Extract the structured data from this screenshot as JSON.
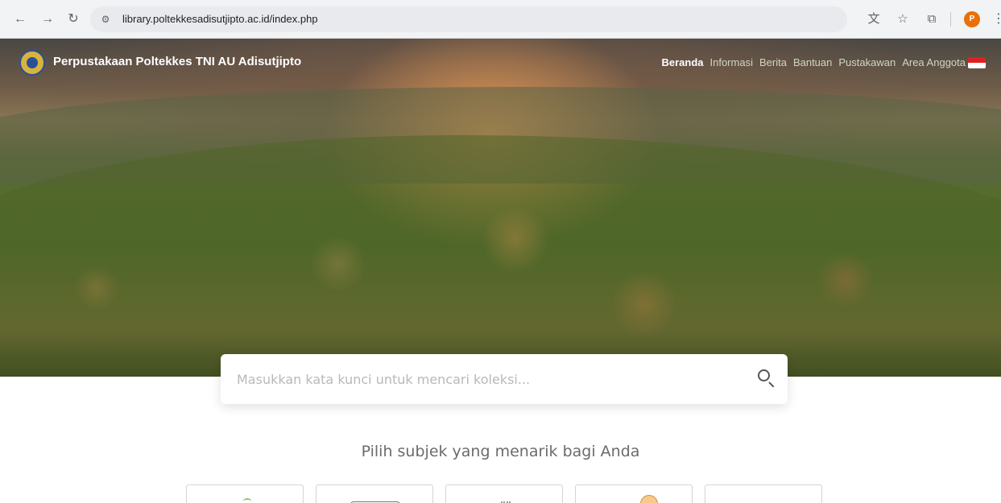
{
  "browser": {
    "url": "library.poltekkesadisutjipto.ac.id/index.php",
    "back_icon": "arrow-left",
    "forward_icon": "arrow-right",
    "reload_icon": "reload",
    "site_info_icon": "tune",
    "translate_icon": "translate",
    "bookmark_icon": "star",
    "extensions_icon": "puzzle",
    "profile_initial": "P",
    "menu_icon": "more-vertical"
  },
  "site": {
    "title": "Perpustakaan Poltekkes TNI AU Adisutjipto",
    "nav": [
      {
        "label": "Beranda",
        "active": true
      },
      {
        "label": "Informasi",
        "active": false
      },
      {
        "label": "Berita",
        "active": false
      },
      {
        "label": "Bantuan",
        "active": false
      },
      {
        "label": "Pustakawan",
        "active": false
      },
      {
        "label": "Area Anggota",
        "active": false
      }
    ],
    "language_flag": "indonesia"
  },
  "search": {
    "placeholder": "Masukkan kata kunci untuk mencari koleksi...",
    "value": ""
  },
  "subjects": {
    "heading": "Pilih subjek yang menarik bagi Anda",
    "cards": [
      {
        "icon": "plant-icon"
      },
      {
        "icon": "device-icon"
      },
      {
        "icon": "dots-icon"
      },
      {
        "icon": "clock-icon"
      },
      {
        "icon": "blank-icon"
      }
    ]
  },
  "colors": {
    "accent": "#e8710a",
    "flag_red": "#e02020"
  }
}
